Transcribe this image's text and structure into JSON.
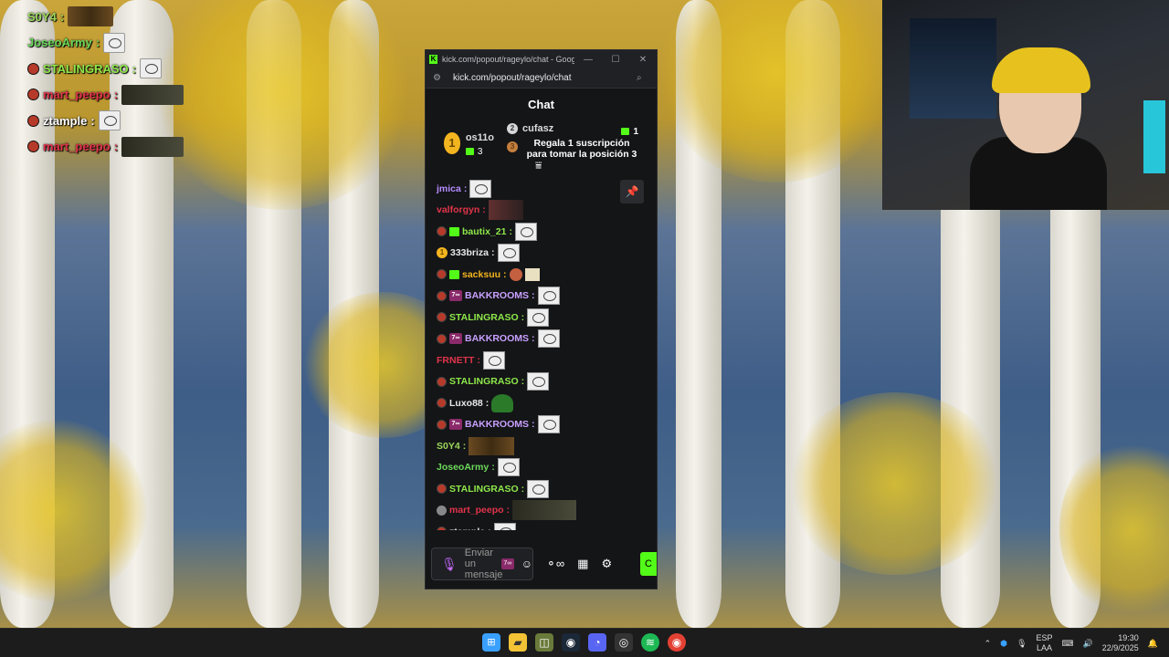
{
  "overlay_chat": [
    {
      "user": "S0Y4",
      "color": "#9bd85a",
      "badge": false,
      "emote": "trio"
    },
    {
      "user": "JoseoArmy",
      "color": "#6bd85a",
      "badge": false,
      "emote": "face"
    },
    {
      "user": "STALINGRASO",
      "color": "#8ee84a",
      "badge": true,
      "emote": "face"
    },
    {
      "user": "mart_peepo",
      "color": "#e0344a",
      "badge": true,
      "emote": "photo"
    },
    {
      "user": "ztample",
      "color": "#ffffff",
      "badge": true,
      "emote": "face"
    },
    {
      "user": "mart_peepo",
      "color": "#e0344a",
      "badge": true,
      "emote": "photo"
    }
  ],
  "window": {
    "title": "kick.com/popout/rageylo/chat - Google...",
    "url": "kick.com/popout/rageylo/chat",
    "min_icon": "minimize-icon",
    "max_icon": "maximize-icon",
    "close_icon": "close-icon"
  },
  "chat": {
    "header": "Chat",
    "leaderboard": {
      "first": {
        "rank": "1",
        "name": "os11o",
        "count": "3"
      },
      "second": {
        "rank": "2",
        "name": "cufasz",
        "count": "1"
      },
      "third": {
        "rank": "3",
        "cta": "Regala 1 suscripción para tomar la posición 3"
      }
    },
    "messages": [
      {
        "user": "jmica",
        "color": "#b48cff",
        "badges": [],
        "emotes": [
          "face"
        ]
      },
      {
        "user": "valforgyn",
        "color": "#e0344a",
        "badges": [],
        "emotes": [
          "photo"
        ]
      },
      {
        "user": "bautix_21",
        "color": "#8ee84a",
        "badges": [
          "mod",
          "sub"
        ],
        "emotes": [
          "face"
        ]
      },
      {
        "user": "333briza",
        "color": "#e8e8e8",
        "badges": [
          "gold"
        ],
        "emotes": [
          "face"
        ]
      },
      {
        "user": "sacksuu",
        "color": "#f3b51f",
        "badges": [
          "mod",
          "sub"
        ],
        "emotes": [
          "tiny",
          "note"
        ]
      },
      {
        "user": "BAKKROOMS",
        "color": "#c9a0ff",
        "badges": [
          "mod",
          "777"
        ],
        "emotes": [
          "face"
        ]
      },
      {
        "user": "STALINGRASO",
        "color": "#8ee84a",
        "badges": [
          "mod"
        ],
        "emotes": [
          "face"
        ]
      },
      {
        "user": "BAKKROOMS",
        "color": "#c9a0ff",
        "badges": [
          "mod",
          "777"
        ],
        "emotes": [
          "face"
        ]
      },
      {
        "user": "FRNETT",
        "color": "#e0344a",
        "badges": [],
        "emotes": [
          "face"
        ]
      },
      {
        "user": "STALINGRASO",
        "color": "#8ee84a",
        "badges": [
          "mod"
        ],
        "emotes": [
          "face"
        ]
      },
      {
        "user": "Luxo88",
        "color": "#e8e8e8",
        "badges": [
          "mod"
        ],
        "emotes": [
          "green"
        ]
      },
      {
        "user": "BAKKROOMS",
        "color": "#c9a0ff",
        "badges": [
          "mod",
          "777"
        ],
        "emotes": [
          "face"
        ]
      },
      {
        "user": "S0Y4",
        "color": "#9bd85a",
        "badges": [],
        "emotes": [
          "trio"
        ]
      },
      {
        "user": "JoseoArmy",
        "color": "#6bd85a",
        "badges": [],
        "emotes": [
          "face"
        ]
      },
      {
        "user": "STALINGRASO",
        "color": "#8ee84a",
        "badges": [
          "mod"
        ],
        "emotes": [
          "face"
        ]
      },
      {
        "user": "mart_peepo",
        "color": "#e0344a",
        "badges": [
          "grey"
        ],
        "emotes": [
          "wide"
        ]
      },
      {
        "user": "ztample",
        "color": "#e8e8e8",
        "badges": [
          "mod"
        ],
        "emotes": [
          "face"
        ]
      }
    ],
    "input": {
      "placeholder": "Enviar un mensaje"
    },
    "badge_777_text": "7∞",
    "send_label": "C"
  },
  "taskbar": {
    "language": "ESP",
    "layout": "LAA",
    "time": "19:30",
    "date": "22/9/2025"
  }
}
